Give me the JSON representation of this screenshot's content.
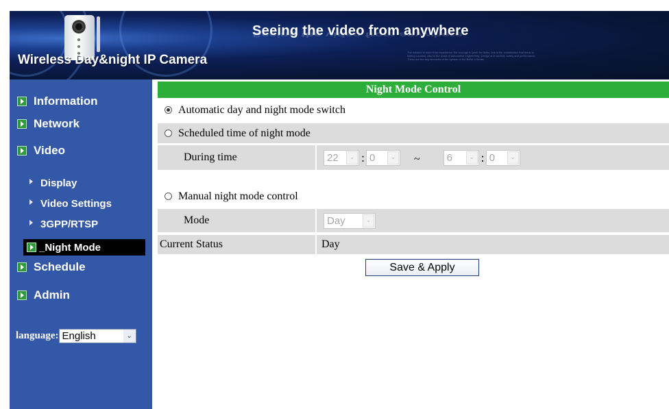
{
  "header": {
    "title": "Seeing the video from anywhere",
    "subtitle": "Wireless Day&night IP Camera",
    "fine_print": "The wisdom to learn from experience, the courage to push the limits, this is the combination that leads to lasting success, also in the world of automotive engineering. Design and comfort, safety and performance. These are the key elements of the system of the BMW 5 Series."
  },
  "sidebar": {
    "items": [
      {
        "label": "Information"
      },
      {
        "label": "Network"
      },
      {
        "label": "Video"
      }
    ],
    "video_sub": [
      {
        "label": "Display"
      },
      {
        "label": "Video Settings"
      },
      {
        "label": "3GPP/RTSP"
      }
    ],
    "active": {
      "label": "_Night Mode"
    },
    "items_after": [
      {
        "label": "Schedule"
      },
      {
        "label": "Admin"
      }
    ],
    "language": {
      "label": "language:",
      "value": "English"
    }
  },
  "form": {
    "title": "Night Mode Control",
    "auto_option": {
      "label": "Automatic day and night mode switch",
      "selected": true
    },
    "scheduled_option": {
      "label": "Scheduled time of night mode",
      "selected": false
    },
    "during_time": {
      "label": "During time",
      "start_hour": "22",
      "start_minute": "0",
      "separator": "~",
      "end_hour": "6",
      "end_minute": "0",
      "colon": ":"
    },
    "manual_option": {
      "label": "Manual night mode control",
      "selected": false
    },
    "mode": {
      "label": "Mode",
      "value": "Day"
    },
    "current_status": {
      "label": "Current Status",
      "value": "Day"
    },
    "save_label": "Save & Apply"
  },
  "colors": {
    "sidebar_bg": "#3458a8",
    "section_header": "#2dae3a",
    "active_item_bg": "#000000",
    "row_grey": "#dcdcdc"
  }
}
